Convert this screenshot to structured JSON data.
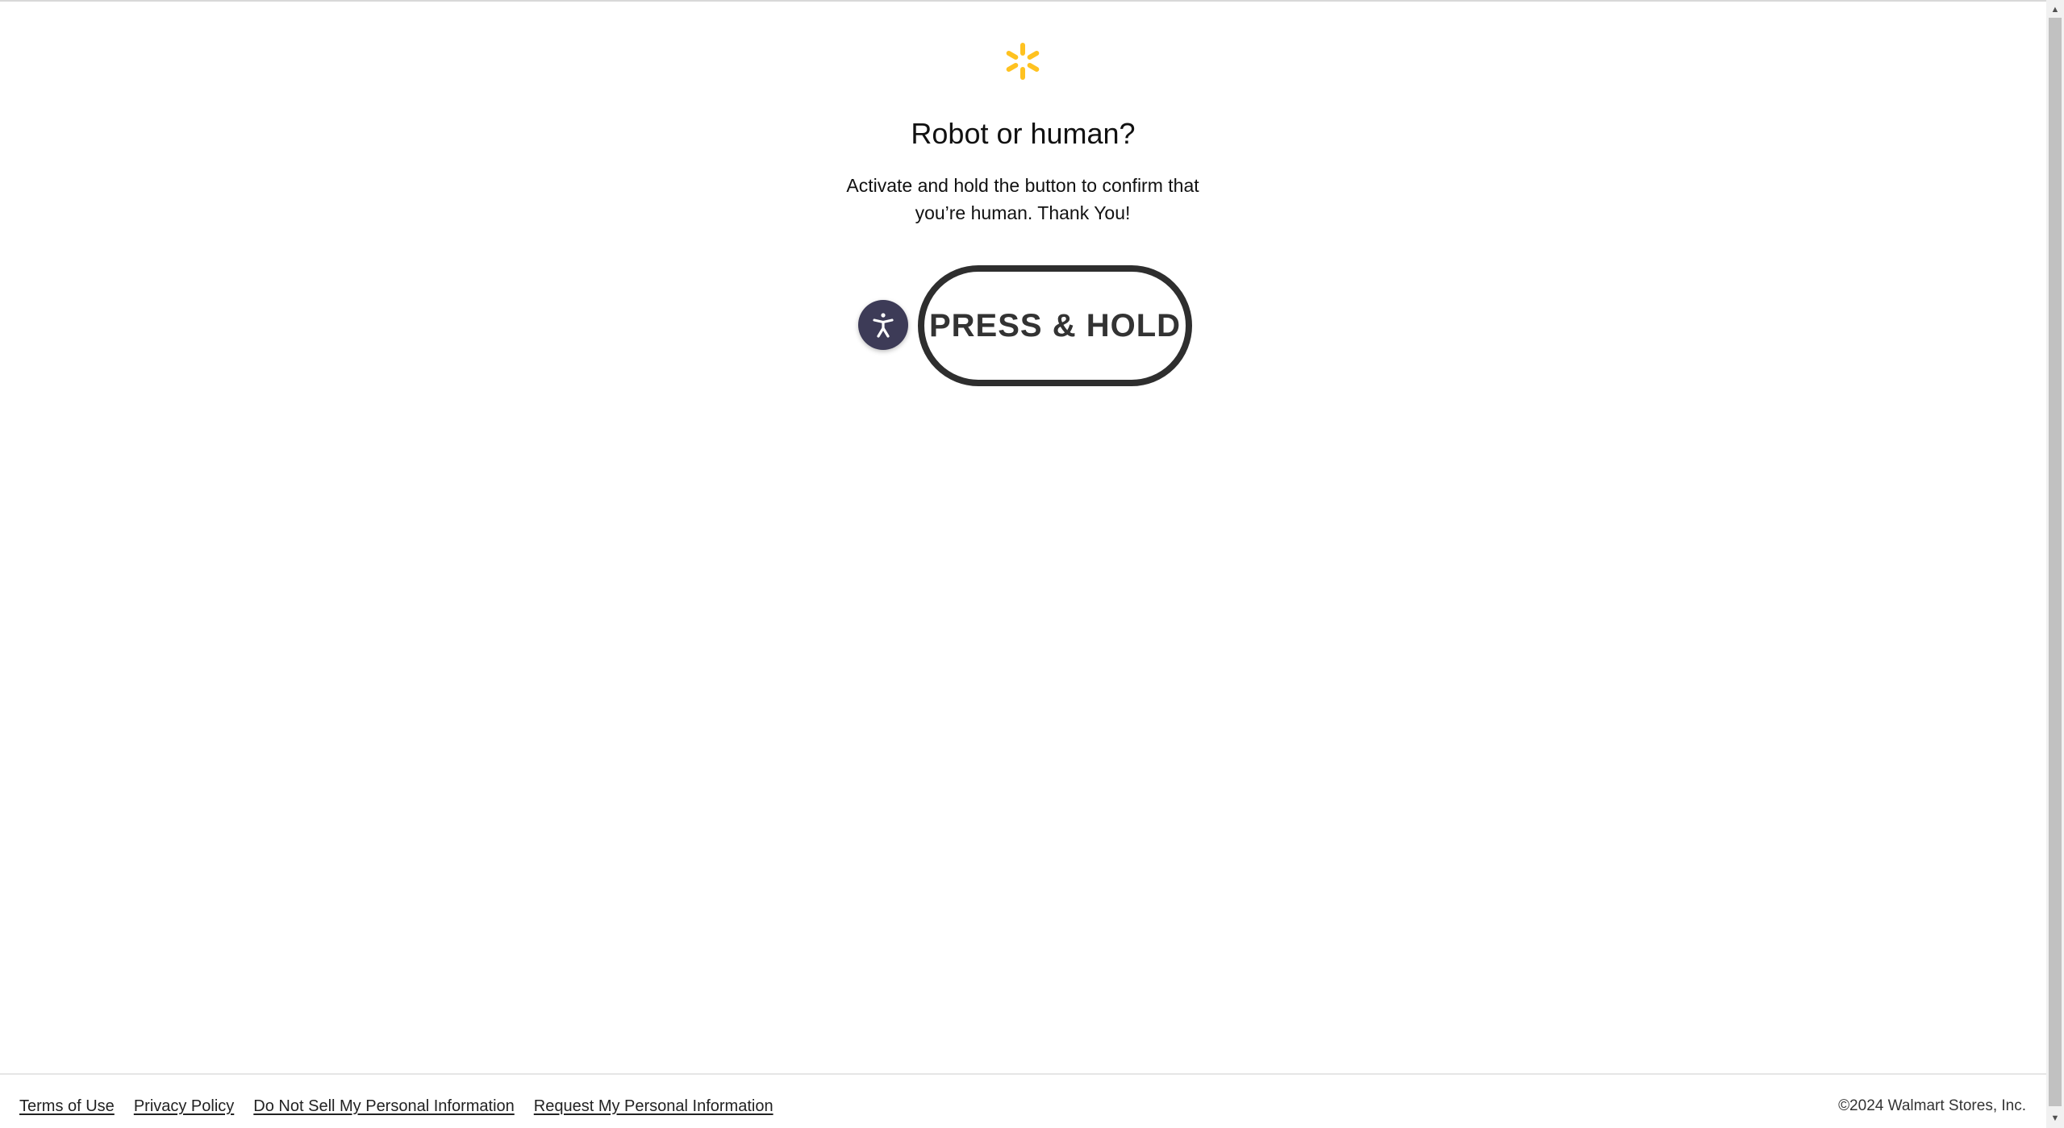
{
  "page": {
    "title": "Robot or human?",
    "instructions": "Activate and hold the button to confirm that you’re human. Thank You!"
  },
  "logo": {
    "icon": "walmart-spark-icon",
    "color": "#ffc220"
  },
  "challenge": {
    "button_label": "PRESS & HOLD",
    "accessibility_icon": "accessibility-icon",
    "accessibility_color": "#3d3b57"
  },
  "footer": {
    "links": [
      "Terms of Use",
      "Privacy Policy",
      "Do Not Sell My Personal Information",
      "Request My Personal Information"
    ],
    "copyright": "©2024 Walmart Stores, Inc."
  },
  "scrollbar": {
    "up_icon": "scroll-up-arrow-icon",
    "down_icon": "scroll-down-arrow-icon"
  }
}
